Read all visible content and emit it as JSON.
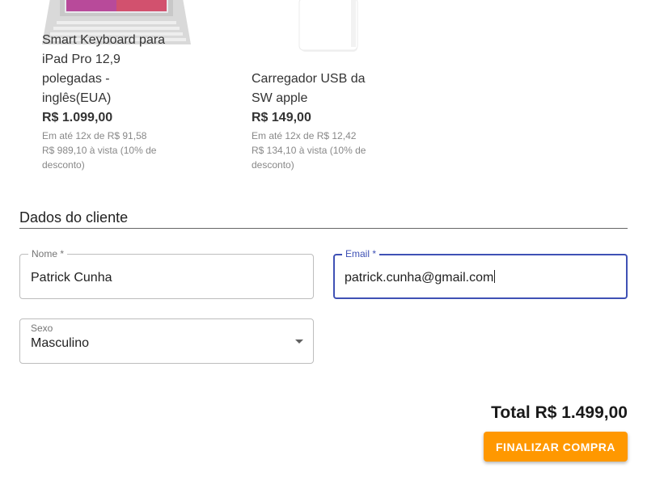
{
  "products": [
    {
      "name": "Smart Keyboard para iPad Pro 12,9 polegadas - inglês(EUA)",
      "price": "R$ 1.099,00",
      "installments": "Em até 12x de R$ 91,58",
      "cash": "R$ 989,10 à vista (10% de desconto)",
      "image_icon": "keyboard-image"
    },
    {
      "name": "Carregador USB da SW apple",
      "price": "R$ 149,00",
      "installments": "Em até 12x de R$ 12,42",
      "cash": "R$ 134,10 à vista (10% de desconto)",
      "image_icon": "charger-image"
    }
  ],
  "customer": {
    "section_title": "Dados do cliente",
    "name_label": "Nome *",
    "name_value": "Patrick Cunha",
    "email_label": "Email *",
    "email_value": "patrick.cunha@gmail.com",
    "sex_label": "Sexo",
    "sex_value": "Masculino"
  },
  "checkout": {
    "total": "Total R$ 1.499,00",
    "finish_label": "FINALIZAR COMPRA",
    "accent_color": "#ff9800",
    "focus_color": "#3f51b5"
  }
}
